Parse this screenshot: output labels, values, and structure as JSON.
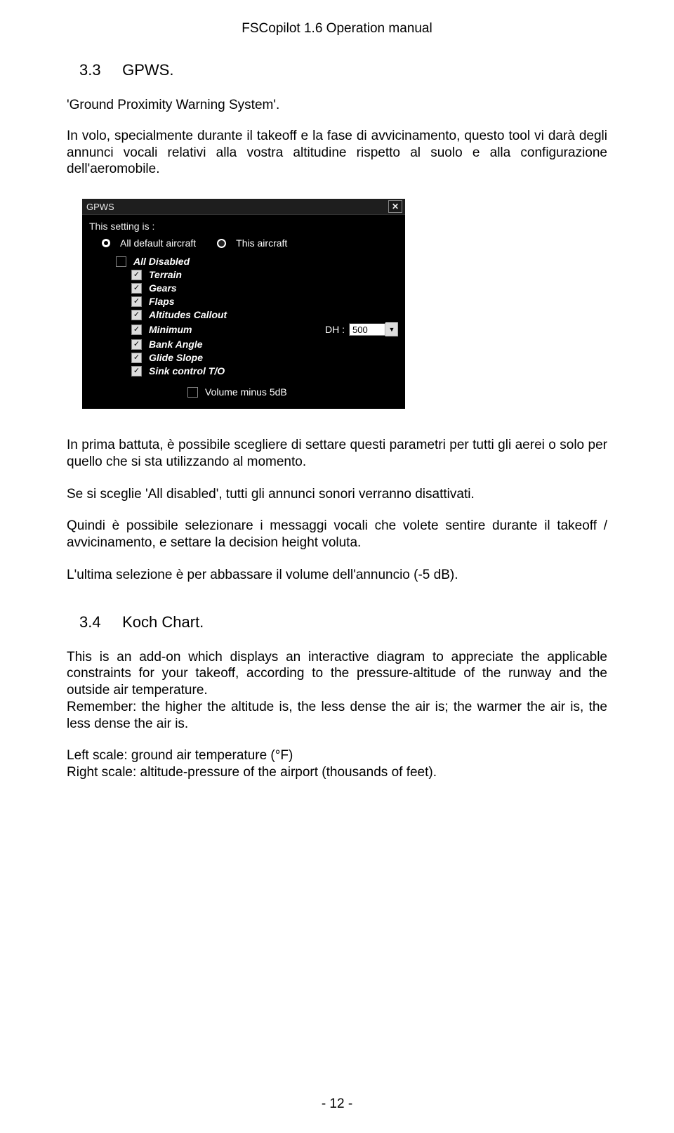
{
  "header": "FSCopilot 1.6 Operation manual",
  "section1": {
    "num": "3.3",
    "title": "GPWS."
  },
  "p1": "'Ground Proximity Warning System'.",
  "p2": "In volo, specialmente durante il takeoff e la fase di avvicinamento, questo tool vi darà degli annunci vocali relativi alla vostra altitudine rispetto al suolo e alla configurazione dell'aeromobile.",
  "gpws": {
    "window_title": "GPWS",
    "setting_label": "This setting is :",
    "radio_all": "All default aircraft",
    "radio_this": "This aircraft",
    "chk_all_disabled": "All Disabled",
    "chk_terrain": "Terrain",
    "chk_gears": "Gears",
    "chk_flaps": "Flaps",
    "chk_alt_callout": "Altitudes Callout",
    "chk_minimum": "Minimum",
    "dh_label": "DH :",
    "dh_value": "500",
    "chk_bank": "Bank Angle",
    "chk_glide": "Glide Slope",
    "chk_sink": "Sink control T/O",
    "chk_volume": "Volume minus 5dB"
  },
  "p3": "In prima battuta, è possibile scegliere di settare questi parametri per tutti gli aerei o solo per quello che si sta utilizzando al momento.",
  "p4": "Se si sceglie 'All disabled', tutti gli annunci sonori verranno disattivati.",
  "p5": "Quindi è possibile  selezionare i messaggi vocali che volete sentire durante il takeoff / avvicinamento, e settare la decision height voluta.",
  "p6": "L'ultima selezione è per abbassare il volume dell'annuncio (-5 dB).",
  "section2": {
    "num": "3.4",
    "title": "Koch Chart."
  },
  "p7": "This is an add-on which displays an interactive diagram to appreciate the applicable constraints for your takeoff, according to the pressure-altitude of the runway and the outside air temperature.",
  "p8": "Remember: the higher the altitude is, the less dense the air is; the warmer the air is, the less dense the air is.",
  "p9": "Left scale: ground air temperature (°F)",
  "p10": "Right scale: altitude-pressure of the airport (thousands of feet).",
  "footer": "- 12 -"
}
